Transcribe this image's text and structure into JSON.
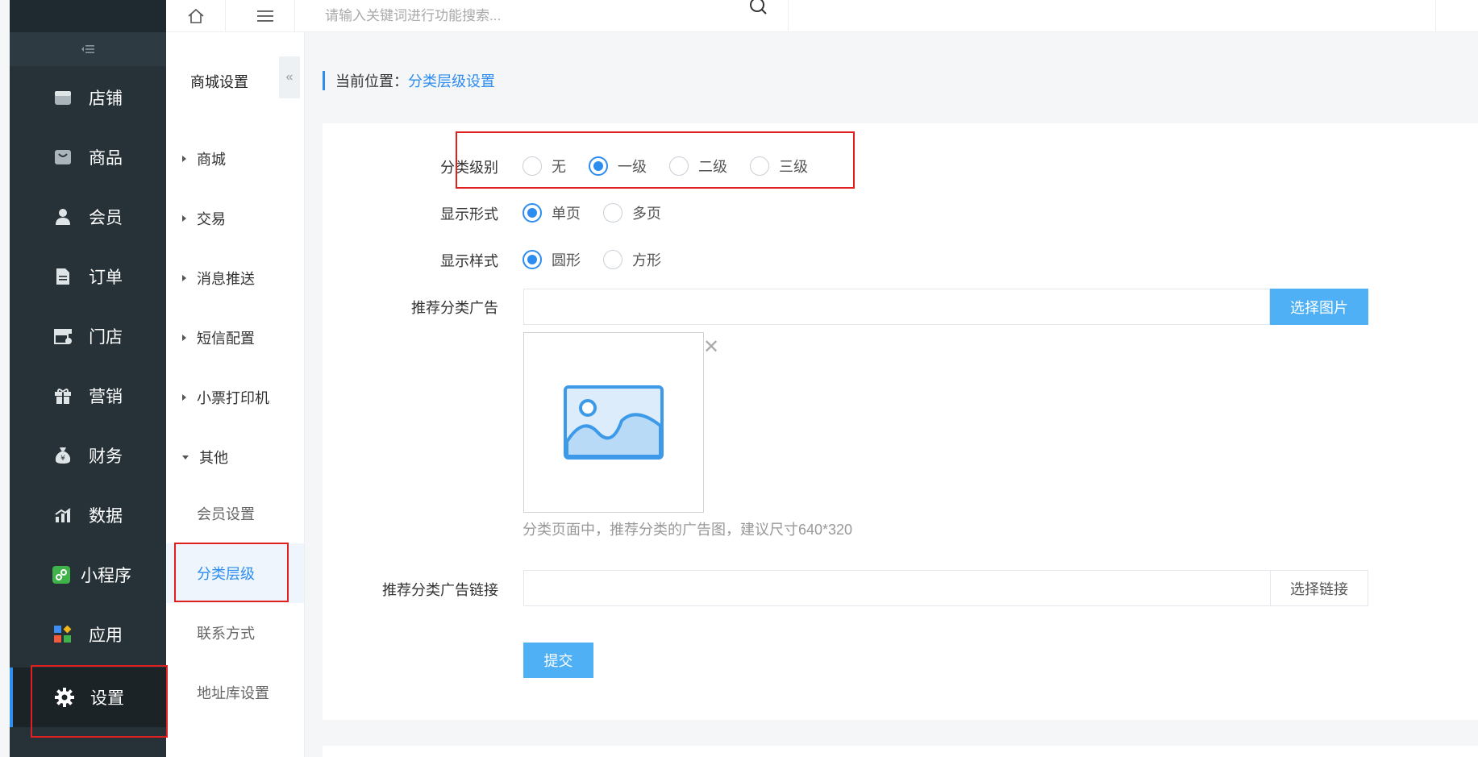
{
  "sidebar": {
    "items": [
      {
        "label": "店铺",
        "icon": "store-icon"
      },
      {
        "label": "商品",
        "icon": "bag-icon"
      },
      {
        "label": "会员",
        "icon": "user-icon"
      },
      {
        "label": "订单",
        "icon": "document-icon"
      },
      {
        "label": "门店",
        "icon": "shop-icon"
      },
      {
        "label": "营销",
        "icon": "gift-icon"
      },
      {
        "label": "财务",
        "icon": "money-bag-icon"
      },
      {
        "label": "数据",
        "icon": "chart-icon"
      },
      {
        "label": "小程序",
        "icon": "miniprogram-icon"
      },
      {
        "label": "应用",
        "icon": "apps-icon"
      },
      {
        "label": "设置",
        "icon": "gear-icon"
      }
    ],
    "active": "设置"
  },
  "subnav": {
    "title": "商城设置",
    "groups": [
      "商城",
      "交易",
      "消息推送",
      "短信配置",
      "小票打印机",
      "其他"
    ],
    "items": [
      "会员设置",
      "分类层级",
      "联系方式",
      "地址库设置"
    ],
    "active": "分类层级"
  },
  "header": {
    "search_placeholder": "请输入关键词进行功能搜索..."
  },
  "breadcrumb": {
    "label": "当前位置：",
    "current": "分类层级设置"
  },
  "form": {
    "level": {
      "label": "分类级别",
      "options": [
        "无",
        "一级",
        "二级",
        "三级"
      ],
      "selected": "一级"
    },
    "display_mode": {
      "label": "显示形式",
      "options": [
        "单页",
        "多页"
      ],
      "selected": "单页"
    },
    "display_style": {
      "label": "显示样式",
      "options": [
        "圆形",
        "方形"
      ],
      "selected": "圆形"
    },
    "ad_image": {
      "label": "推荐分类广告",
      "value": "",
      "button": "选择图片",
      "hint": "分类页面中，推荐分类的广告图，建议尺寸640*320"
    },
    "ad_link": {
      "label": "推荐分类广告链接",
      "value": "",
      "button": "选择链接"
    },
    "submit": "提交"
  },
  "colors": {
    "accent": "#2d8cf0",
    "sidebar_bg": "#263238",
    "highlight_box": "#e02020",
    "primary_button": "#4fb0f5"
  }
}
